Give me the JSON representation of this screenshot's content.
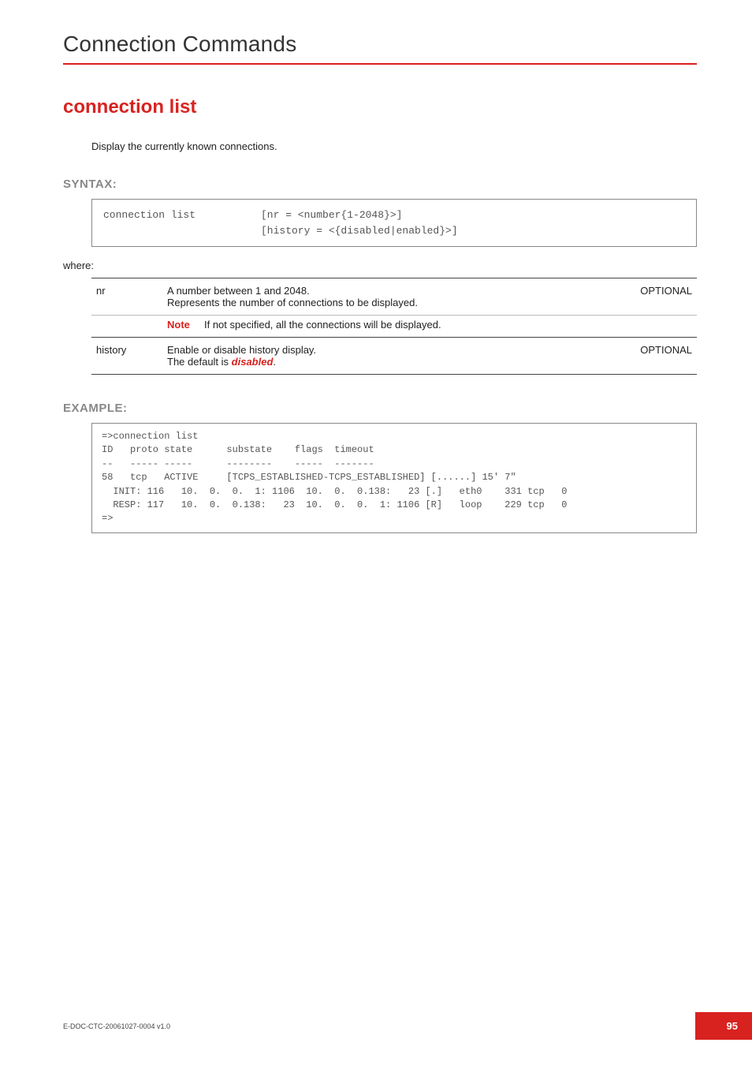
{
  "header": {
    "section_title": "Connection Commands"
  },
  "command": {
    "title": "connection list",
    "intro": "Display the currently known connections."
  },
  "syntax": {
    "heading": "SYNTAX:",
    "cmd": "connection list",
    "args_line1": "[nr = <number{1-2048}>]",
    "args_line2": "[history = <{disabled|enabled}>]",
    "where_label": "where:"
  },
  "params": [
    {
      "name": "nr",
      "desc": "A number between 1 and 2048.\nRepresents the number of connections to be displayed.",
      "note_label": "Note",
      "note_text": "If not specified, all the connections will be displayed.",
      "optional": "OPTIONAL"
    },
    {
      "name": "history",
      "desc_pre": "Enable or disable history display.\nThe default is ",
      "default_word": "disabled",
      "desc_post": ".",
      "optional": "OPTIONAL"
    }
  ],
  "example": {
    "heading": "EXAMPLE:",
    "text": "=>connection list\nID   proto state      substate    flags  timeout\n--   ----- -----      --------    -----  -------\n58   tcp   ACTIVE     [TCPS_ESTABLISHED-TCPS_ESTABLISHED] [......] 15' 7\"\n  INIT: 116   10.  0.  0.  1: 1106  10.  0.  0.138:   23 [.]   eth0    331 tcp   0\n  RESP: 117   10.  0.  0.138:   23  10.  0.  0.  1: 1106 [R]   loop    229 tcp   0\n=>"
  },
  "footer": {
    "doc_id": "E-DOC-CTC-20061027-0004 v1.0",
    "page": "95"
  }
}
